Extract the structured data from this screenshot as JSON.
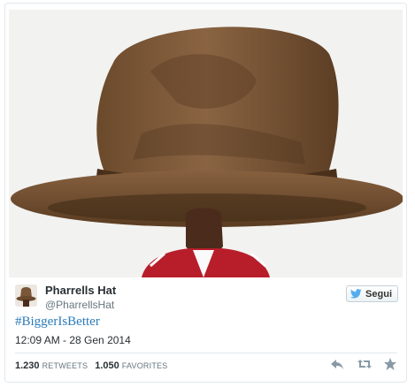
{
  "tweet": {
    "author_name": "Pharrells Hat",
    "author_handle": "@PharrellsHat",
    "text": "#BiggerIsBetter",
    "timestamp": "12:09 AM - 28 Gen 2014",
    "follow_label": "Segui",
    "retweets_count": "1.230",
    "retweets_label": "RETWEETS",
    "favorites_count": "1.050",
    "favorites_label": "FAVORITES"
  },
  "icons": {
    "follow": "twitter-bird-icon",
    "reply": "reply-icon",
    "retweet": "retweet-icon",
    "favorite": "star-icon"
  },
  "colors": {
    "hashtag": "#2b7bb9",
    "bird": "#55acee",
    "action_icons": "#8899a6"
  }
}
